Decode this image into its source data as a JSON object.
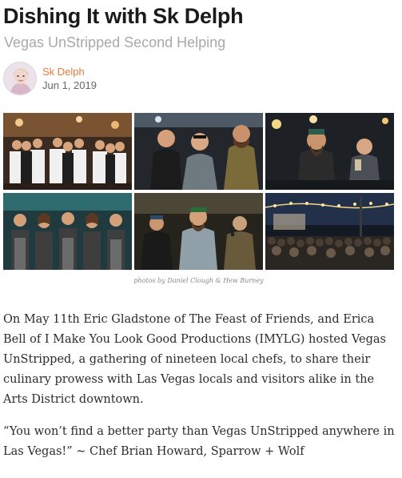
{
  "article": {
    "title": "Dishing It with Sk Delph",
    "subtitle": "Vegas UnStripped Second Helping"
  },
  "author": {
    "name": "Sk Delph",
    "date": "Jun 1, 2019"
  },
  "gallery": {
    "photos": [
      {
        "alt": "group-of-chefs-photo"
      },
      {
        "alt": "chefs-talking-photo"
      },
      {
        "alt": "chef-holding-drink-photo"
      },
      {
        "alt": "chefs-in-aprons-photo"
      },
      {
        "alt": "chefs-with-microphone-photo"
      },
      {
        "alt": "night-crowd-photo"
      }
    ],
    "caption": "photos by Daniel Clough & Hew Burney"
  },
  "body": {
    "paragraph1": "On May 11th Eric Gladstone of The Feast of Friends, and Erica Bell of I Make You Look Good Productions (IMYLG) hosted Vegas UnStripped, a gathering of nineteen local chefs, to share their culinary prowess with Las Vegas locals and visitors alike in the Arts District downtown.",
    "paragraph2": "“You won’t find a better party than Vegas UnStripped anywhere in Las Vegas!” ~ Chef Brian Howard, Sparrow + Wolf"
  }
}
